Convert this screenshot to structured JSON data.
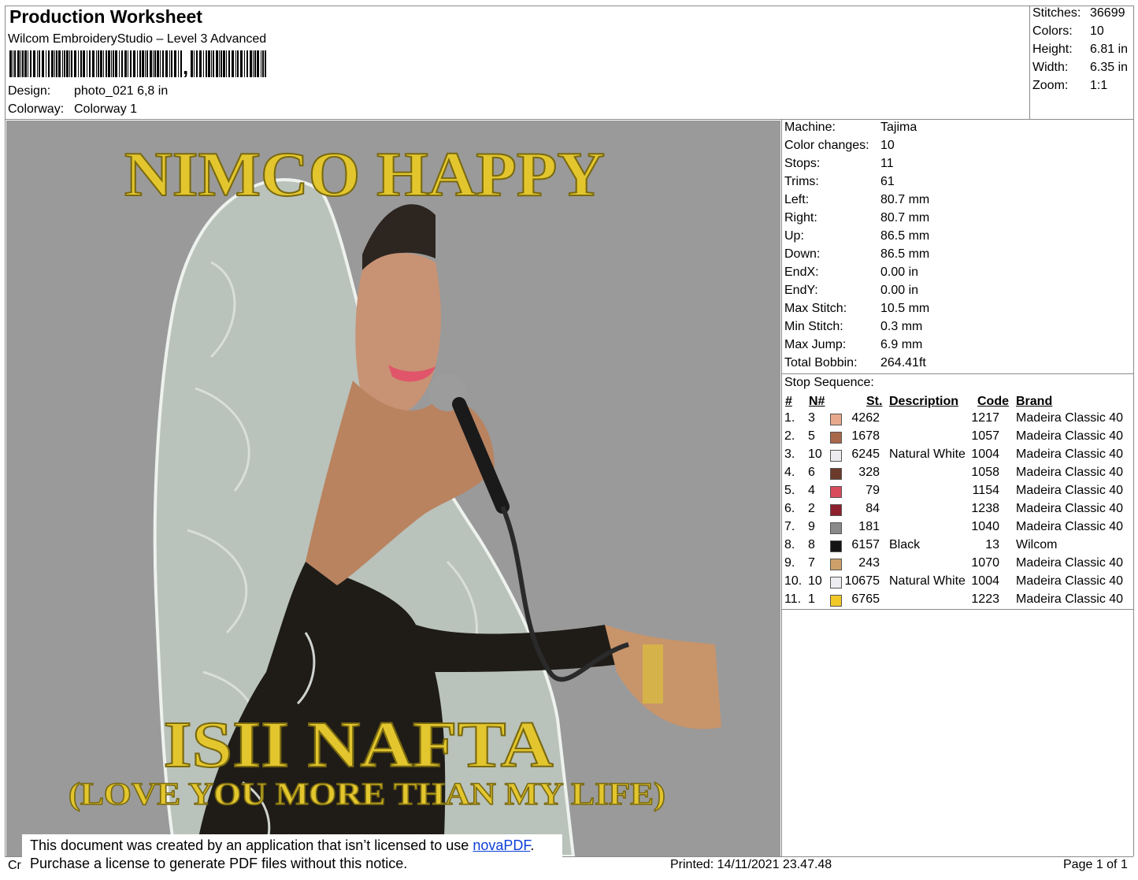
{
  "header": {
    "title": "Production Worksheet",
    "subtitle": "Wilcom EmbroideryStudio – Level 3 Advanced",
    "design_label": "Design:",
    "design_value": "photo_021 6,8 in",
    "colorway_label": "Colorway:",
    "colorway_value": "Colorway 1"
  },
  "summary": [
    {
      "label": "Stitches:",
      "value": "36699"
    },
    {
      "label": "Colors:",
      "value": "10"
    },
    {
      "label": "Height:",
      "value": "6.81 in"
    },
    {
      "label": "Width:",
      "value": "6.35 in"
    },
    {
      "label": "Zoom:",
      "value": "1:1"
    }
  ],
  "design_text": {
    "top": "NIMCO HAPPY",
    "middle": "ISII NAFTA",
    "bottom": "(LOVE YOU MORE THAN MY LIFE)"
  },
  "machine_info": [
    {
      "label": "Machine:",
      "value": "Tajima"
    },
    {
      "label": "Color changes:",
      "value": "10"
    },
    {
      "label": "Stops:",
      "value": "11"
    },
    {
      "label": "Trims:",
      "value": "61"
    },
    {
      "label": "Left:",
      "value": "80.7 mm"
    },
    {
      "label": "Right:",
      "value": "80.7 mm"
    },
    {
      "label": "Up:",
      "value": "86.5 mm"
    },
    {
      "label": "Down:",
      "value": "86.5 mm"
    },
    {
      "label": "EndX:",
      "value": "0.00 in"
    },
    {
      "label": "EndY:",
      "value": "0.00 in"
    },
    {
      "label": "Max Stitch:",
      "value": "10.5 mm"
    },
    {
      "label": "Min Stitch:",
      "value": "0.3 mm"
    },
    {
      "label": "Max Jump:",
      "value": "6.9 mm"
    },
    {
      "label": "Total Bobbin:",
      "value": "264.41ft"
    }
  ],
  "stop_sequence": {
    "label": "Stop Sequence:",
    "headers": {
      "num": "#",
      "n": "N#",
      "st": "St.",
      "description": "Description",
      "code": "Code",
      "brand": "Brand"
    },
    "rows": [
      {
        "num": "1.",
        "n": "3",
        "color": "#e8a88c",
        "st": "4262",
        "description": "",
        "code": "1217",
        "brand": "Madeira Classic 40"
      },
      {
        "num": "2.",
        "n": "5",
        "color": "#a8684a",
        "st": "1678",
        "description": "",
        "code": "1057",
        "brand": "Madeira Classic 40"
      },
      {
        "num": "3.",
        "n": "10",
        "color": "#ececf0",
        "st": "6245",
        "description": "Natural White",
        "code": "1004",
        "brand": "Madeira Classic 40"
      },
      {
        "num": "4.",
        "n": "6",
        "color": "#6b3a2a",
        "st": "328",
        "description": "",
        "code": "1058",
        "brand": "Madeira Classic 40"
      },
      {
        "num": "5.",
        "n": "4",
        "color": "#d94c5e",
        "st": "79",
        "description": "",
        "code": "1154",
        "brand": "Madeira Classic 40"
      },
      {
        "num": "6.",
        "n": "2",
        "color": "#8e1f2c",
        "st": "84",
        "description": "",
        "code": "1238",
        "brand": "Madeira Classic 40"
      },
      {
        "num": "7.",
        "n": "9",
        "color": "#8a8a8a",
        "st": "181",
        "description": "",
        "code": "1040",
        "brand": "Madeira Classic 40"
      },
      {
        "num": "8.",
        "n": "8",
        "color": "#141414",
        "st": "6157",
        "description": "Black",
        "code": "13",
        "brand": "Wilcom"
      },
      {
        "num": "9.",
        "n": "7",
        "color": "#cfa06a",
        "st": "243",
        "description": "",
        "code": "1070",
        "brand": "Madeira Classic 40"
      },
      {
        "num": "10.",
        "n": "10",
        "color": "#ececf0",
        "st": "10675",
        "description": "Natural White",
        "code": "1004",
        "brand": "Madeira Classic 40"
      },
      {
        "num": "11.",
        "n": "1",
        "color": "#f0c828",
        "st": "6765",
        "description": "",
        "code": "1223",
        "brand": "Madeira Classic 40"
      }
    ]
  },
  "notice": {
    "line1_text": "This document was created by an application that isn’t licensed to use ",
    "line1_link": "novaPDF",
    "line1_end": ".",
    "line2": "Purchase a license to generate PDF files without this notice."
  },
  "footer": {
    "left": "Cr",
    "printed": "Printed: 14/11/2021 23.47.48",
    "page": "Page 1 of 1"
  },
  "colors": {
    "preview_bg": "#9a9a9a",
    "gold": "#e3c62e",
    "hood": "#b9c2bb",
    "link": "#0b3fd6"
  }
}
